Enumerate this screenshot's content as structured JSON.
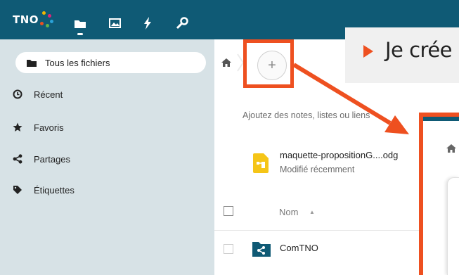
{
  "header": {
    "logo_text": "TNO",
    "nav_icons": [
      "files-icon",
      "photos-icon",
      "activity-icon",
      "passwords-icon"
    ]
  },
  "sidebar": {
    "items": [
      {
        "label": "Tous les fichiers",
        "icon": "folder-icon",
        "active": true
      },
      {
        "label": "Récent",
        "icon": "clock-icon"
      },
      {
        "label": "Favoris",
        "icon": "star-icon"
      },
      {
        "label": "Partages",
        "icon": "share-icon"
      },
      {
        "label": "Étiquettes",
        "icon": "tag-icon"
      }
    ]
  },
  "main": {
    "add_label": "+",
    "description": "Ajoutez des notes, listes ou liens",
    "recent_file": {
      "name": "maquette-propositionG....odg",
      "subtitle": "Modifié récemment"
    },
    "table": {
      "header_name": "Nom",
      "rows": [
        {
          "name": "ComTNO",
          "icon": "shared-folder-icon"
        }
      ]
    }
  },
  "overlay": {
    "banner_text": "Je crée",
    "accent_color": "#ee5020"
  },
  "colors": {
    "header_bg": "#0f5a75",
    "sidebar_bg": "#d7e2e6",
    "accent": "#ee5020"
  }
}
